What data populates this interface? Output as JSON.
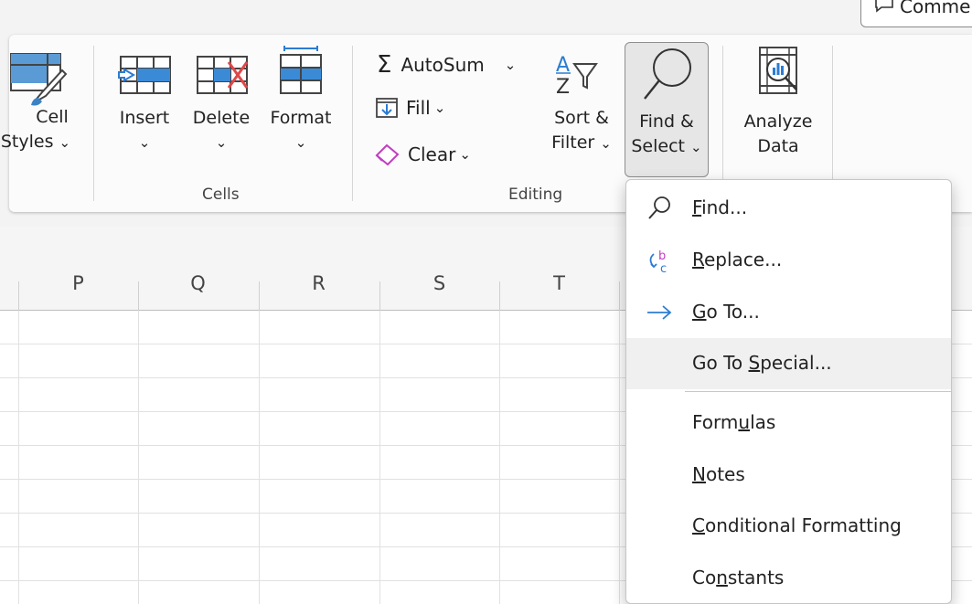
{
  "top": {
    "comments_label": "Comme"
  },
  "ribbon": {
    "styles_group": {
      "cell_styles_line1": "Cell",
      "cell_styles_line2": "Styles",
      "chevron": "⌄"
    },
    "cells_group": {
      "label": "Cells",
      "insert": "Insert",
      "delete": "Delete",
      "format": "Format",
      "chevron": "⌄"
    },
    "editing_group": {
      "label": "Editing",
      "autosum": "AutoSum",
      "fill": "Fill",
      "clear": "Clear",
      "sort_line1": "Sort &",
      "sort_line2": "Filter",
      "find_line1": "Find &",
      "find_line2": "Select",
      "chevron": "⌄"
    },
    "analysis_group": {
      "analyze_line1": "Analyze",
      "analyze_line2": "Data"
    }
  },
  "grid": {
    "columns": [
      "P",
      "Q",
      "R",
      "S",
      "T"
    ]
  },
  "menu": {
    "items": [
      {
        "pre": "",
        "ul": "F",
        "post": "ind...",
        "icon": "search-icon"
      },
      {
        "pre": "",
        "ul": "R",
        "post": "eplace...",
        "icon": "replace-icon"
      },
      {
        "pre": "",
        "ul": "G",
        "post": "o To...",
        "icon": "arrow-right-icon"
      },
      {
        "pre": "Go To ",
        "ul": "S",
        "post": "pecial...",
        "icon": ""
      },
      {
        "pre": "Form",
        "ul": "u",
        "post": "las",
        "icon": ""
      },
      {
        "pre": "",
        "ul": "N",
        "post": "otes",
        "icon": ""
      },
      {
        "pre": "",
        "ul": "C",
        "post": "onditional Formatting",
        "icon": ""
      },
      {
        "pre": "Co",
        "ul": "n",
        "post": "stants",
        "icon": ""
      }
    ]
  },
  "colors": {
    "accent_blue": "#2b7cd3",
    "delete_red": "#e04848",
    "hover_bg": "#f0f0f0",
    "button_pressed_bg": "#e6e6e6"
  }
}
